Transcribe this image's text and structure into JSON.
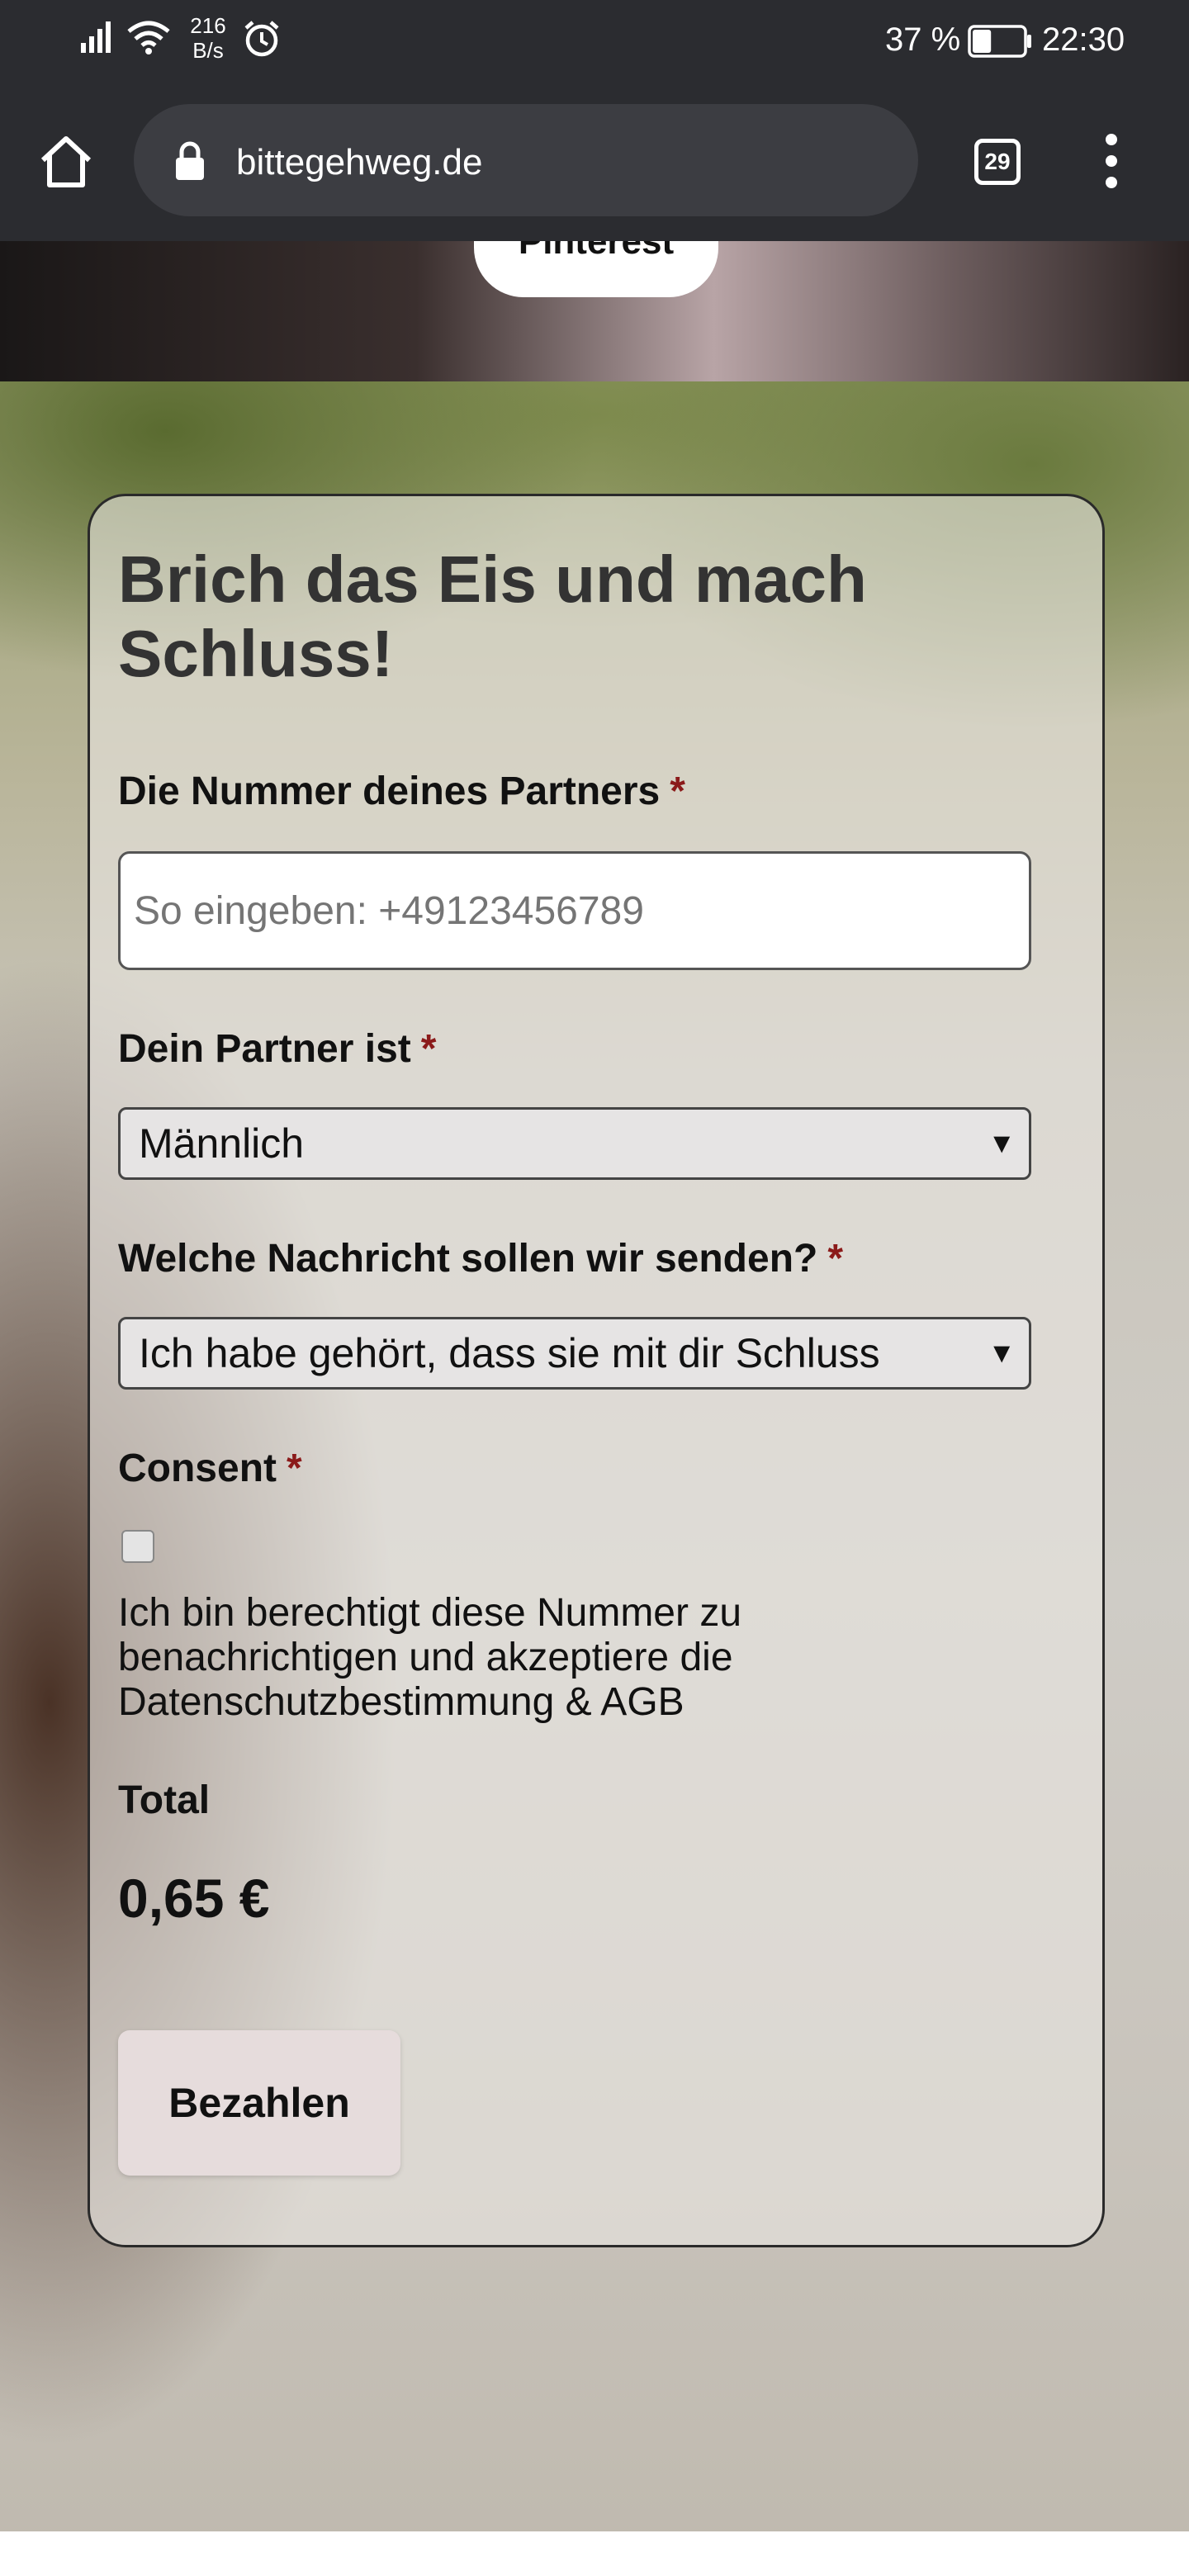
{
  "status_bar": {
    "net_speed_value": "216",
    "net_speed_unit": "B/s",
    "battery_percent": "37 %",
    "battery_level": 0.37,
    "time": "22:30"
  },
  "browser": {
    "url": "bittegehweg.de",
    "tab_count": "29"
  },
  "page": {
    "pinterest_label": "Pinterest",
    "form": {
      "title": "Brich das Eis und mach Schluss!",
      "phone_label": "Die Nummer deines Partners",
      "phone_placeholder": "So eingeben: +49123456789",
      "gender_label": "Dein Partner ist",
      "gender_value": "Männlich",
      "message_label": "Welche Nachricht sollen wir senden?",
      "message_value": "Ich habe gehört, dass sie mit dir Schluss",
      "consent_label": "Consent",
      "consent_text": "Ich bin berechtigt diese Nummer zu benachrichtigen und akzeptiere die Datenschutzbestimmung & AGB",
      "consent_checked": false,
      "required_marker": "*",
      "total_label": "Total",
      "total_value": "0,65 €",
      "pay_button_label": "Bezahlen"
    }
  }
}
